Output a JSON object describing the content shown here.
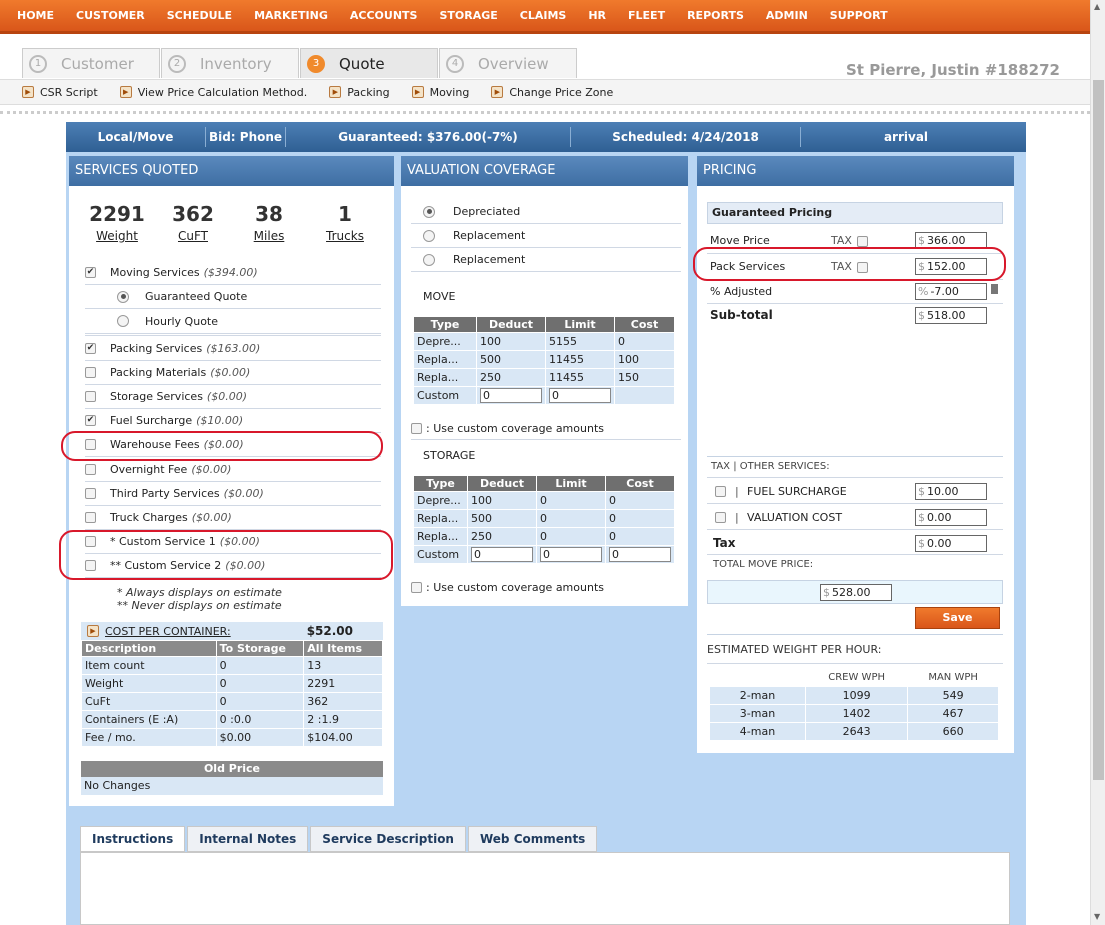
{
  "nav": [
    "HOME",
    "CUSTOMER",
    "SCHEDULE",
    "MARKETING",
    "ACCOUNTS",
    "STORAGE",
    "CLAIMS",
    "HR",
    "FLEET",
    "REPORTS",
    "ADMIN",
    "SUPPORT"
  ],
  "steps": [
    {
      "num": "1",
      "label": "Customer"
    },
    {
      "num": "2",
      "label": "Inventory"
    },
    {
      "num": "3",
      "label": "Quote"
    },
    {
      "num": "4",
      "label": "Overview"
    }
  ],
  "customer_name": "St Pierre, Justin #188272",
  "toolbar": [
    "CSR Script",
    "View Price Calculation Method.",
    "Packing",
    "Moving",
    "Change Price Zone"
  ],
  "header": {
    "type": "Local/Move",
    "bid": "Bid: Phone",
    "guaranteed": "Guaranteed: $376.00(-7%)",
    "scheduled": "Scheduled:   4/24/2018",
    "arrival": "arrival"
  },
  "services": {
    "title": "SERVICES QUOTED",
    "stats": [
      {
        "value": "2291",
        "label": "Weight"
      },
      {
        "value": "362",
        "label": "CuFT"
      },
      {
        "value": "38",
        "label": "Miles"
      },
      {
        "value": "1",
        "label": "Trucks"
      }
    ],
    "moving": {
      "label": "Moving Services",
      "amount": "($394.00)"
    },
    "quote_options": [
      "Guaranteed Quote",
      "Hourly Quote"
    ],
    "items": [
      {
        "label": "Packing Services",
        "amount": "($163.00)",
        "checked": "✔"
      },
      {
        "label": "Packing Materials",
        "amount": "($0.00)",
        "checked": ""
      },
      {
        "label": "Storage Services",
        "amount": "($0.00)",
        "checked": ""
      },
      {
        "label": "Fuel Surcharge",
        "amount": "($10.00)",
        "checked": "✔"
      },
      {
        "label": "Warehouse Fees",
        "amount": "($0.00)",
        "checked": ""
      },
      {
        "label": "Overnight Fee",
        "amount": "($0.00)",
        "checked": ""
      },
      {
        "label": "Third Party Services",
        "amount": "($0.00)",
        "checked": ""
      },
      {
        "label": "Truck Charges",
        "amount": "($0.00)",
        "checked": ""
      },
      {
        "label": "* Custom Service 1",
        "amount": "($0.00)",
        "checked": ""
      },
      {
        "label": "** Custom Service 2",
        "amount": "($0.00)",
        "checked": ""
      }
    ],
    "note1": "* Always displays on estimate",
    "note2": "** Never displays on estimate",
    "cpc_label": "COST PER CONTAINER:",
    "cpc_value": "$52.00",
    "cpc_headers": [
      "Description",
      "To Storage",
      "All Items"
    ],
    "cpc_rows": [
      [
        "Item count",
        "0",
        "13"
      ],
      [
        "Weight",
        "0",
        "2291"
      ],
      [
        "CuFt",
        "0",
        "362"
      ],
      [
        "Containers (E :A)",
        "0 :0.0",
        "2 :1.9"
      ],
      [
        "Fee / mo.",
        "$0.00",
        "$104.00"
      ]
    ],
    "old_price_header": "Old Price",
    "old_price_value": "No Changes"
  },
  "valuation": {
    "title": "VALUATION COVERAGE",
    "options": [
      "Depreciated",
      "Replacement",
      "Replacement"
    ],
    "move_label": "MOVE",
    "storage_label": "STORAGE",
    "headers": [
      "Type",
      "Deduct",
      "Limit",
      "Cost"
    ],
    "move_rows": [
      [
        "Depre...",
        "100",
        "5155",
        "0"
      ],
      [
        "Repla...",
        "500",
        "11455",
        "100"
      ],
      [
        "Repla...",
        "250",
        "11455",
        "150"
      ]
    ],
    "storage_rows": [
      [
        "Depre...",
        "100",
        "0",
        "0"
      ],
      [
        "Repla...",
        "500",
        "0",
        "0"
      ],
      [
        "Repla...",
        "250",
        "0",
        "0"
      ]
    ],
    "custom_label": "Custom",
    "custom_move": [
      "0",
      "0"
    ],
    "custom_storage": [
      "0",
      "0",
      "0"
    ],
    "use_custom": ": Use custom coverage amounts"
  },
  "pricing": {
    "title": "PRICING",
    "guaranteed_header": "Guaranteed Pricing",
    "move_price_label": "Move Price",
    "move_price": "366.00",
    "pack_label": "Pack Services",
    "pack_price": "152.00",
    "tax_label": "TAX",
    "adjusted_label": "% Adjusted",
    "adjusted": "-7.00",
    "subtotal_label": "Sub-total",
    "subtotal": "518.00",
    "other_header": "TAX | OTHER SERVICES:",
    "fuel_label": "FUEL SURCHARGE",
    "fuel": "10.00",
    "valuation_label": "VALUATION COST",
    "valuation": "0.00",
    "tax_total_label": "Tax",
    "tax_total": "0.00",
    "total_label": "TOTAL MOVE PRICE:",
    "total": "528.00",
    "save": "Save",
    "wph_header": "ESTIMATED WEIGHT PER HOUR:",
    "wph_cols": [
      "CREW WPH",
      "MAN WPH"
    ],
    "wph_rows": [
      [
        "2-man",
        "1099",
        "549"
      ],
      [
        "3-man",
        "1402",
        "467"
      ],
      [
        "4-man",
        "2643",
        "660"
      ]
    ]
  },
  "tabs": [
    "Instructions",
    "Internal Notes",
    "Service Description",
    "Web Comments"
  ]
}
